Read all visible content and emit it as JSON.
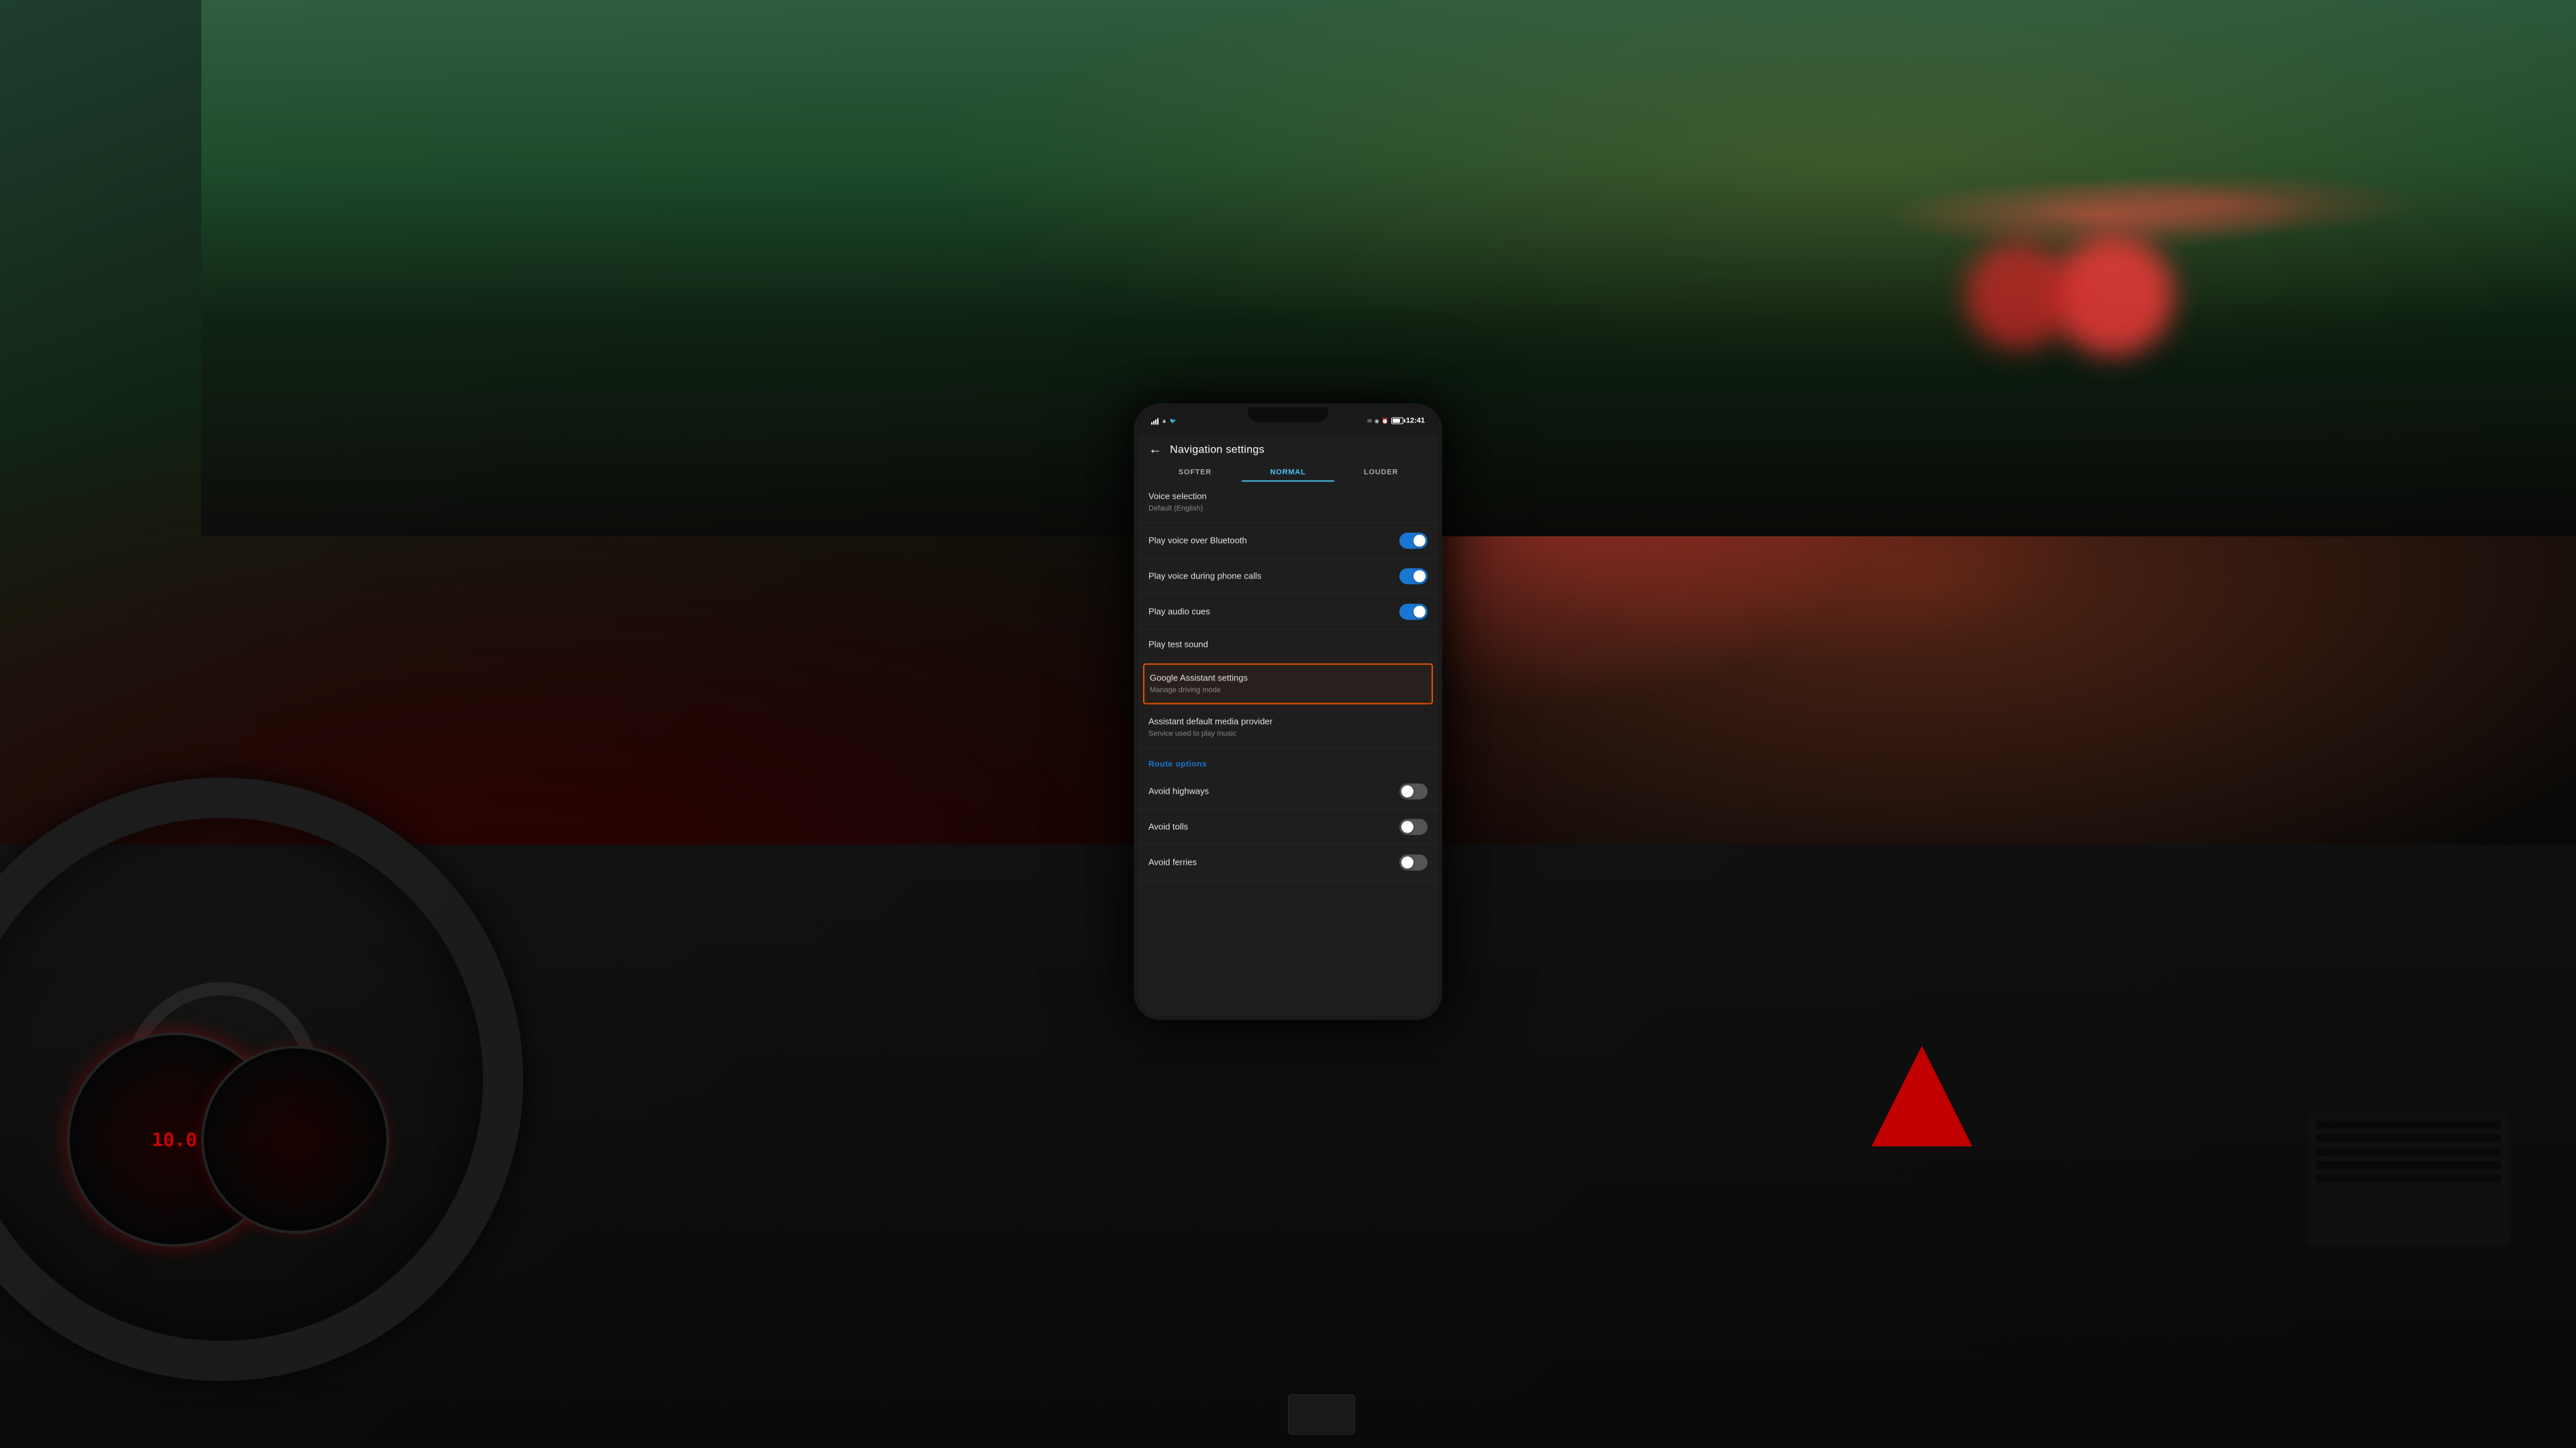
{
  "background": {
    "description": "Car interior with phone showing navigation settings"
  },
  "phone": {
    "status_bar": {
      "signal": "▋▋▋",
      "wifi": "wifi",
      "time": "12:41",
      "battery_level": 70,
      "icons": [
        "sim",
        "wifi",
        "location",
        "battery"
      ]
    },
    "header": {
      "back_label": "←",
      "title": "Navigation settings"
    },
    "volume_tabs": [
      {
        "label": "SOFTER",
        "active": false
      },
      {
        "label": "NORMAL",
        "active": true
      },
      {
        "label": "LOUDER",
        "active": false
      }
    ],
    "settings": [
      {
        "id": "voice-selection",
        "title": "Voice selection",
        "subtitle": "Default (English)",
        "type": "link",
        "toggle": null
      },
      {
        "id": "play-voice-bluetooth",
        "title": "Play voice over Bluetooth",
        "subtitle": null,
        "type": "toggle",
        "toggle": "on"
      },
      {
        "id": "play-voice-calls",
        "title": "Play voice during phone calls",
        "subtitle": null,
        "type": "toggle",
        "toggle": "on"
      },
      {
        "id": "play-audio-cues",
        "title": "Play audio cues",
        "subtitle": null,
        "type": "toggle",
        "toggle": "on"
      },
      {
        "id": "play-test-sound",
        "title": "Play test sound",
        "subtitle": null,
        "type": "link",
        "toggle": null
      },
      {
        "id": "google-assistant-settings",
        "title": "Google Assistant settings",
        "subtitle": "Manage driving mode",
        "type": "link",
        "toggle": null,
        "highlighted": true
      },
      {
        "id": "assistant-default-media",
        "title": "Assistant default media provider",
        "subtitle": "Service used to play music",
        "type": "link",
        "toggle": null
      }
    ],
    "route_options": {
      "section_title": "Route options",
      "items": [
        {
          "id": "avoid-highways",
          "title": "Avoid highways",
          "toggle": "off"
        },
        {
          "id": "avoid-tolls",
          "title": "Avoid tolls",
          "toggle": "off"
        },
        {
          "id": "avoid-ferries",
          "title": "Avoid ferries",
          "toggle": "off"
        }
      ]
    }
  },
  "icons": {
    "back_arrow": "←",
    "signal_bars": "▌▌▌",
    "wifi_symbol": "⊕",
    "battery": "🔋"
  },
  "colors": {
    "accent_blue": "#1976d2",
    "toggle_on": "#1976d2",
    "toggle_off": "#555555",
    "highlight_orange": "#e65100",
    "text_primary": "#e0e0e0",
    "text_secondary": "#888888",
    "background_dark": "#1e1e1e",
    "screen_bg": "#1a1a1a"
  }
}
